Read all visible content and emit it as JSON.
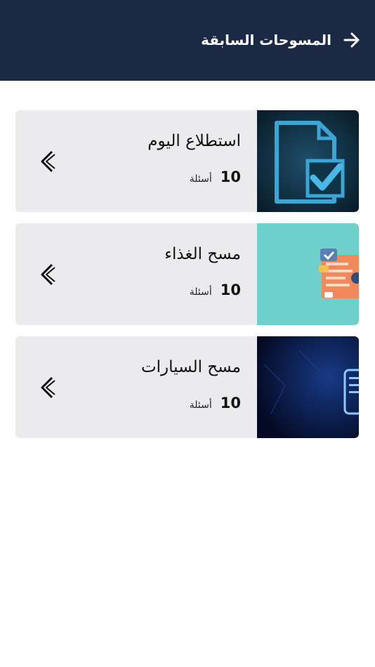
{
  "header": {
    "title": "المسوحات السابقة",
    "back_icon": "arrow-right-icon",
    "background": "#1b2944"
  },
  "surveys": [
    {
      "title": "استطلاع اليوم",
      "count": "10",
      "unit": "أسئلة",
      "thumbnail": "document-checkmark-icon"
    },
    {
      "title": "مسح الغذاء",
      "count": "10",
      "unit": "أسئلة",
      "thumbnail": "survey-illustration"
    },
    {
      "title": "مسح السيارات",
      "count": "10",
      "unit": "أسئلة",
      "thumbnail": "glowing-document-icon"
    }
  ],
  "colors": {
    "card_background": "#ebebed",
    "text": "#111111"
  }
}
